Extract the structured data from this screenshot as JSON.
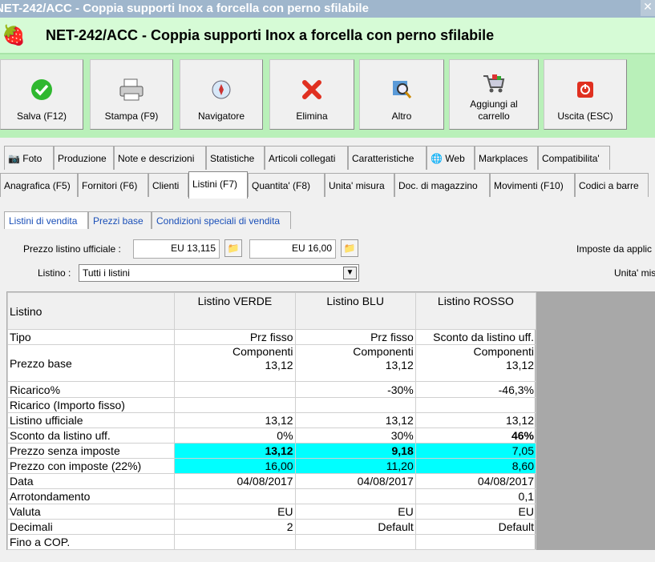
{
  "window": {
    "title": "NET-242/ACC - Coppia supporti Inox a forcella con perno sfilabile"
  },
  "header": {
    "title": "NET-242/ACC - Coppia supporti Inox a forcella con perno sfilabile"
  },
  "toolbar": {
    "save": "Salva (F12)",
    "print": "Stampa (F9)",
    "navigator": "Navigatore",
    "delete": "Elimina",
    "other": "Altro",
    "add_cart": "Aggiungi al carrello",
    "exit": "Uscita (ESC)"
  },
  "tabs_row1": [
    "Foto",
    "Produzione",
    "Note e descrizioni",
    "Statistiche",
    "Articoli collegati",
    "Caratteristiche",
    "Web",
    "Markplaces",
    "Compatibilita'"
  ],
  "tabs_row2": [
    "Anagrafica (F5)",
    "Fornitori (F6)",
    "Clienti",
    "Listini (F7)",
    "Quantita' (F8)",
    "Unita' misura",
    "Doc. di magazzino",
    "Movimenti (F10)",
    "Codici a barre"
  ],
  "subtabs": [
    "Listini di vendita",
    "Prezzi base",
    "Condizioni speciali di vendita"
  ],
  "form": {
    "prezzo_label": "Prezzo listino ufficiale :",
    "prezzo1": "EU 13,115",
    "prezzo2": "EU 16,00",
    "imposte_label": "Imposte da applic",
    "listino_label": "Listino :",
    "listino_value": "Tutti i listini",
    "unita_label": "Unita' mis"
  },
  "grid": {
    "headers": [
      "Listino",
      "Listino VERDE",
      "Listino BLU",
      "Listino ROSSO"
    ],
    "rows": [
      {
        "label": "Tipo",
        "v": [
          "Prz fisso",
          "Prz fisso",
          "Sconto da listino uff."
        ]
      },
      {
        "label": "Prezzo base",
        "v": [
          "Componenti",
          "Componenti",
          "Componenti"
        ],
        "v2": [
          "13,12",
          "13,12",
          "13,12"
        ]
      },
      {
        "label": "Ricarico%",
        "v": [
          "",
          "-30%",
          "-46,3%"
        ]
      },
      {
        "label": "Ricarico (Importo fisso)",
        "v": [
          "",
          "",
          ""
        ]
      },
      {
        "label": "Listino ufficiale",
        "v": [
          "13,12",
          "13,12",
          "13,12"
        ]
      },
      {
        "label": "Sconto da listino uff.",
        "v": [
          "0%",
          "30%",
          "46%"
        ]
      },
      {
        "label": "Prezzo senza imposte",
        "v": [
          "13,12",
          "9,18",
          "7,05"
        ]
      },
      {
        "label": "Prezzo con imposte (22%)",
        "v": [
          "16,00",
          "11,20",
          "8,60"
        ]
      },
      {
        "label": "Data",
        "v": [
          "04/08/2017",
          "04/08/2017",
          "04/08/2017"
        ]
      },
      {
        "label": "Arrotondamento",
        "v": [
          "",
          "",
          "0,1"
        ]
      },
      {
        "label": "Valuta",
        "v": [
          "EU",
          "EU",
          "EU"
        ]
      },
      {
        "label": "Decimali",
        "v": [
          "2",
          "Default",
          "Default"
        ]
      },
      {
        "label": "Fino a COP.",
        "v": [
          "",
          "",
          ""
        ]
      }
    ]
  }
}
